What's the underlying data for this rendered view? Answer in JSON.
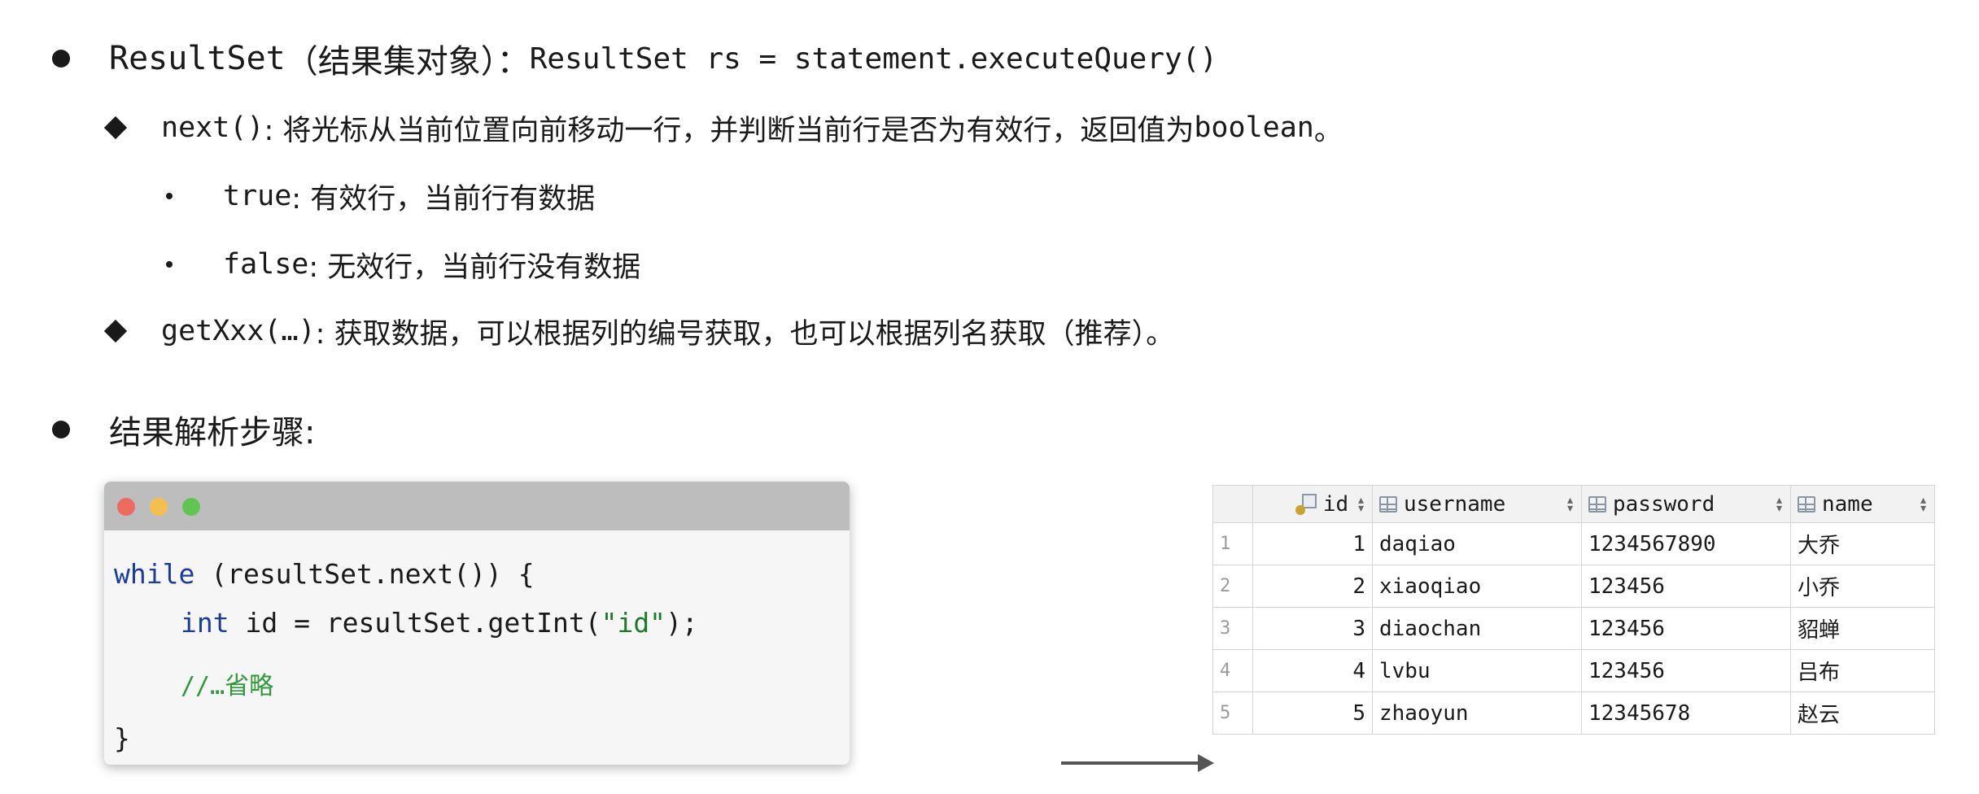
{
  "lines": {
    "resultset_name": "ResultSet",
    "resultset_paren": "（结果集对象）：",
    "resultset_code": "ResultSet rs = statement.executeQuery()",
    "next_code": "next()",
    "next_desc": ": 将光标从当前位置向前移动一行，并判断当前行是否为有效行，返回值为",
    "next_type": "boolean",
    "next_end": "。",
    "true_code": "true",
    "true_desc": ": 有效行，当前行有数据",
    "false_code": "false",
    "false_desc": ": 无效行，当前行没有数据",
    "getxxx_code": "getXxx(…)",
    "getxxx_desc": ": 获取数据，可以根据列的编号获取，也可以根据列名获取（推荐）。",
    "steps_title": "结果解析步骤:"
  },
  "code": {
    "l1_kw": "while",
    "l1_rest": " (resultSet.next()) {",
    "l2_kw": "int",
    "l2_a": " id = resultSet.getInt(",
    "l2_str": "\"id\"",
    "l2_b": ");",
    "l3_comment": "//…省略",
    "l4": "}"
  },
  "table": {
    "headers": [
      "id",
      "username",
      "password",
      "name"
    ],
    "rows": [
      {
        "n": "1",
        "id": "1",
        "username": "daqiao",
        "password": "1234567890",
        "name": "大乔"
      },
      {
        "n": "2",
        "id": "2",
        "username": "xiaoqiao",
        "password": "123456",
        "name": "小乔"
      },
      {
        "n": "3",
        "id": "3",
        "username": "diaochan",
        "password": "123456",
        "name": "貂蝉"
      },
      {
        "n": "4",
        "id": "4",
        "username": "lvbu",
        "password": "123456",
        "name": "吕布"
      },
      {
        "n": "5",
        "id": "5",
        "username": "zhaoyun",
        "password": "12345678",
        "name": "赵云"
      }
    ]
  },
  "colors": {
    "keyword": "#1a3d9e",
    "string": "#1d7a2a",
    "comment": "#2e9a3a",
    "light_red": "#ed6a5e",
    "light_yellow": "#f5bf4f",
    "light_green": "#61c554"
  }
}
